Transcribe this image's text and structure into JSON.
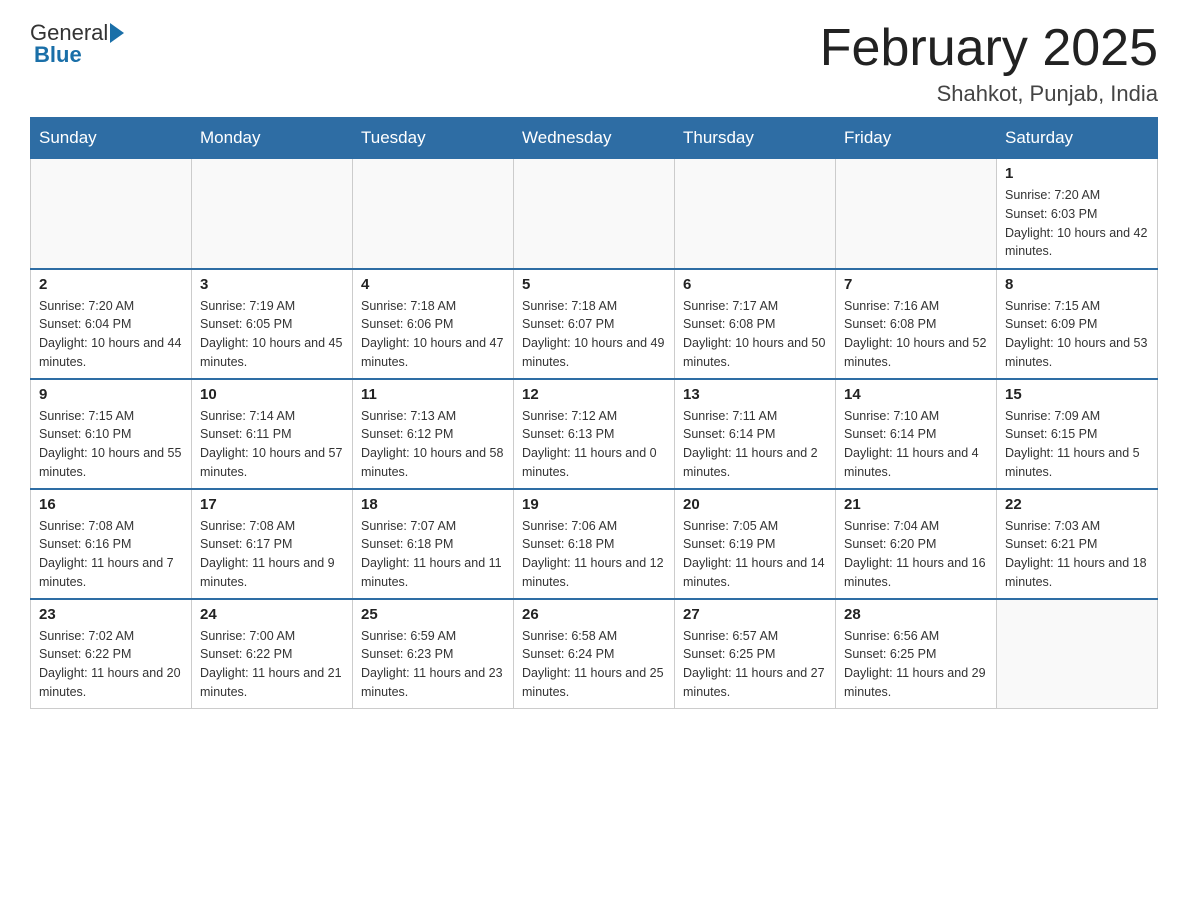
{
  "header": {
    "logo_general": "General",
    "logo_blue": "Blue",
    "month_title": "February 2025",
    "location": "Shahkot, Punjab, India"
  },
  "days_of_week": [
    "Sunday",
    "Monday",
    "Tuesday",
    "Wednesday",
    "Thursday",
    "Friday",
    "Saturday"
  ],
  "weeks": [
    [
      {
        "day": "",
        "sunrise": "",
        "sunset": "",
        "daylight": ""
      },
      {
        "day": "",
        "sunrise": "",
        "sunset": "",
        "daylight": ""
      },
      {
        "day": "",
        "sunrise": "",
        "sunset": "",
        "daylight": ""
      },
      {
        "day": "",
        "sunrise": "",
        "sunset": "",
        "daylight": ""
      },
      {
        "day": "",
        "sunrise": "",
        "sunset": "",
        "daylight": ""
      },
      {
        "day": "",
        "sunrise": "",
        "sunset": "",
        "daylight": ""
      },
      {
        "day": "1",
        "sunrise": "Sunrise: 7:20 AM",
        "sunset": "Sunset: 6:03 PM",
        "daylight": "Daylight: 10 hours and 42 minutes."
      }
    ],
    [
      {
        "day": "2",
        "sunrise": "Sunrise: 7:20 AM",
        "sunset": "Sunset: 6:04 PM",
        "daylight": "Daylight: 10 hours and 44 minutes."
      },
      {
        "day": "3",
        "sunrise": "Sunrise: 7:19 AM",
        "sunset": "Sunset: 6:05 PM",
        "daylight": "Daylight: 10 hours and 45 minutes."
      },
      {
        "day": "4",
        "sunrise": "Sunrise: 7:18 AM",
        "sunset": "Sunset: 6:06 PM",
        "daylight": "Daylight: 10 hours and 47 minutes."
      },
      {
        "day": "5",
        "sunrise": "Sunrise: 7:18 AM",
        "sunset": "Sunset: 6:07 PM",
        "daylight": "Daylight: 10 hours and 49 minutes."
      },
      {
        "day": "6",
        "sunrise": "Sunrise: 7:17 AM",
        "sunset": "Sunset: 6:08 PM",
        "daylight": "Daylight: 10 hours and 50 minutes."
      },
      {
        "day": "7",
        "sunrise": "Sunrise: 7:16 AM",
        "sunset": "Sunset: 6:08 PM",
        "daylight": "Daylight: 10 hours and 52 minutes."
      },
      {
        "day": "8",
        "sunrise": "Sunrise: 7:15 AM",
        "sunset": "Sunset: 6:09 PM",
        "daylight": "Daylight: 10 hours and 53 minutes."
      }
    ],
    [
      {
        "day": "9",
        "sunrise": "Sunrise: 7:15 AM",
        "sunset": "Sunset: 6:10 PM",
        "daylight": "Daylight: 10 hours and 55 minutes."
      },
      {
        "day": "10",
        "sunrise": "Sunrise: 7:14 AM",
        "sunset": "Sunset: 6:11 PM",
        "daylight": "Daylight: 10 hours and 57 minutes."
      },
      {
        "day": "11",
        "sunrise": "Sunrise: 7:13 AM",
        "sunset": "Sunset: 6:12 PM",
        "daylight": "Daylight: 10 hours and 58 minutes."
      },
      {
        "day": "12",
        "sunrise": "Sunrise: 7:12 AM",
        "sunset": "Sunset: 6:13 PM",
        "daylight": "Daylight: 11 hours and 0 minutes."
      },
      {
        "day": "13",
        "sunrise": "Sunrise: 7:11 AM",
        "sunset": "Sunset: 6:14 PM",
        "daylight": "Daylight: 11 hours and 2 minutes."
      },
      {
        "day": "14",
        "sunrise": "Sunrise: 7:10 AM",
        "sunset": "Sunset: 6:14 PM",
        "daylight": "Daylight: 11 hours and 4 minutes."
      },
      {
        "day": "15",
        "sunrise": "Sunrise: 7:09 AM",
        "sunset": "Sunset: 6:15 PM",
        "daylight": "Daylight: 11 hours and 5 minutes."
      }
    ],
    [
      {
        "day": "16",
        "sunrise": "Sunrise: 7:08 AM",
        "sunset": "Sunset: 6:16 PM",
        "daylight": "Daylight: 11 hours and 7 minutes."
      },
      {
        "day": "17",
        "sunrise": "Sunrise: 7:08 AM",
        "sunset": "Sunset: 6:17 PM",
        "daylight": "Daylight: 11 hours and 9 minutes."
      },
      {
        "day": "18",
        "sunrise": "Sunrise: 7:07 AM",
        "sunset": "Sunset: 6:18 PM",
        "daylight": "Daylight: 11 hours and 11 minutes."
      },
      {
        "day": "19",
        "sunrise": "Sunrise: 7:06 AM",
        "sunset": "Sunset: 6:18 PM",
        "daylight": "Daylight: 11 hours and 12 minutes."
      },
      {
        "day": "20",
        "sunrise": "Sunrise: 7:05 AM",
        "sunset": "Sunset: 6:19 PM",
        "daylight": "Daylight: 11 hours and 14 minutes."
      },
      {
        "day": "21",
        "sunrise": "Sunrise: 7:04 AM",
        "sunset": "Sunset: 6:20 PM",
        "daylight": "Daylight: 11 hours and 16 minutes."
      },
      {
        "day": "22",
        "sunrise": "Sunrise: 7:03 AM",
        "sunset": "Sunset: 6:21 PM",
        "daylight": "Daylight: 11 hours and 18 minutes."
      }
    ],
    [
      {
        "day": "23",
        "sunrise": "Sunrise: 7:02 AM",
        "sunset": "Sunset: 6:22 PM",
        "daylight": "Daylight: 11 hours and 20 minutes."
      },
      {
        "day": "24",
        "sunrise": "Sunrise: 7:00 AM",
        "sunset": "Sunset: 6:22 PM",
        "daylight": "Daylight: 11 hours and 21 minutes."
      },
      {
        "day": "25",
        "sunrise": "Sunrise: 6:59 AM",
        "sunset": "Sunset: 6:23 PM",
        "daylight": "Daylight: 11 hours and 23 minutes."
      },
      {
        "day": "26",
        "sunrise": "Sunrise: 6:58 AM",
        "sunset": "Sunset: 6:24 PM",
        "daylight": "Daylight: 11 hours and 25 minutes."
      },
      {
        "day": "27",
        "sunrise": "Sunrise: 6:57 AM",
        "sunset": "Sunset: 6:25 PM",
        "daylight": "Daylight: 11 hours and 27 minutes."
      },
      {
        "day": "28",
        "sunrise": "Sunrise: 6:56 AM",
        "sunset": "Sunset: 6:25 PM",
        "daylight": "Daylight: 11 hours and 29 minutes."
      },
      {
        "day": "",
        "sunrise": "",
        "sunset": "",
        "daylight": ""
      }
    ]
  ]
}
